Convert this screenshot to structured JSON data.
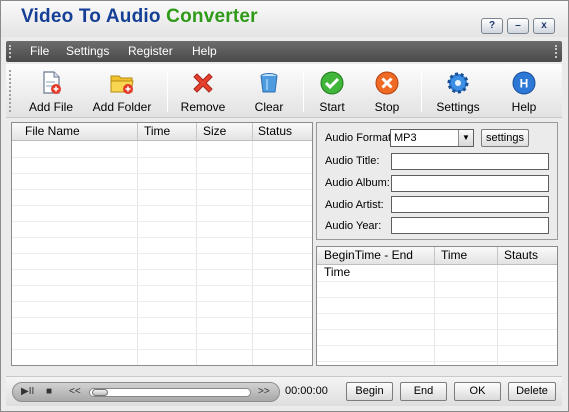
{
  "window": {
    "title_part1": "Video To Audio",
    "title_part2": "Converter",
    "controls": [
      "?",
      "–",
      "x"
    ]
  },
  "menu": {
    "items": [
      "File",
      "Settings",
      "Register",
      "Help"
    ]
  },
  "toolbar": {
    "buttons": [
      {
        "label": "Add File",
        "icon": "add-file-icon"
      },
      {
        "label": "Add Folder",
        "icon": "add-folder-icon"
      },
      {
        "label": "Remove",
        "icon": "remove-icon"
      },
      {
        "label": "Clear",
        "icon": "clear-icon"
      },
      {
        "label": "Start",
        "icon": "start-icon"
      },
      {
        "label": "Stop",
        "icon": "stop-icon"
      },
      {
        "label": "Settings",
        "icon": "settings-gear-icon"
      },
      {
        "label": "Help",
        "icon": "help-icon"
      }
    ]
  },
  "file_list": {
    "columns": [
      "File Name",
      "Time",
      "Size",
      "Status"
    ],
    "rows": []
  },
  "audio": {
    "format_label": "Audio Format",
    "format_value": "MP3",
    "settings_label": "settings",
    "title_label": "Audio Title:",
    "album_label": "Audio Album:",
    "artist_label": "Audio Artist:",
    "year_label": "Audio Year:",
    "title_value": "",
    "album_value": "",
    "artist_value": "",
    "year_value": ""
  },
  "time_list": {
    "columns": [
      "BeginTime - End Time",
      "Time",
      "Stauts"
    ],
    "rows": []
  },
  "player": {
    "play_pause": "▶II",
    "stop": "■",
    "rewind": "<<",
    "forward": ">>",
    "timecode": "00:00:00",
    "progress": 0
  },
  "bottom_buttons": {
    "begin": "Begin",
    "end": "End",
    "ok": "OK",
    "delete": "Delete"
  },
  "colors": {
    "title_blue": "#153f97",
    "title_green": "#2e9a18",
    "menubar": "#5a5a5a"
  }
}
